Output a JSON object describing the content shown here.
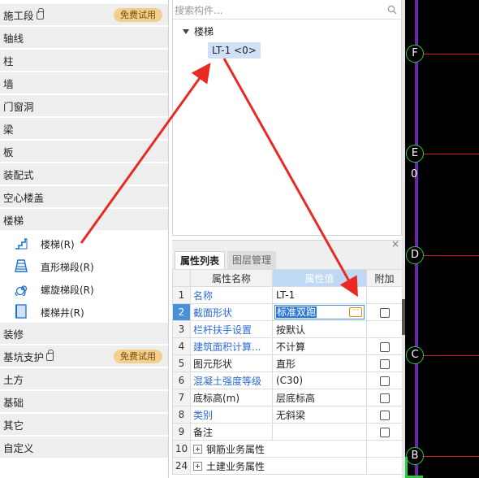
{
  "sidebar": {
    "categories": [
      {
        "label": "施工段",
        "locked": true,
        "badge": "免费试用"
      },
      {
        "label": "轴线"
      },
      {
        "label": "柱"
      },
      {
        "label": "墙"
      },
      {
        "label": "门窗洞"
      },
      {
        "label": "梁"
      },
      {
        "label": "板"
      },
      {
        "label": "装配式"
      },
      {
        "label": "空心楼盖"
      },
      {
        "label": "楼梯"
      },
      {
        "label": "装修"
      },
      {
        "label": "基坑支护",
        "locked": true,
        "badge": "免费试用"
      },
      {
        "label": "土方"
      },
      {
        "label": "基础"
      },
      {
        "label": "其它"
      },
      {
        "label": "自定义"
      }
    ],
    "stair_items": [
      {
        "label": "楼梯(R)",
        "icon": "stair-icon"
      },
      {
        "label": "直形梯段(R)",
        "icon": "straight-flight-icon"
      },
      {
        "label": "螺旋梯段(R)",
        "icon": "spiral-flight-icon"
      },
      {
        "label": "楼梯井(R)",
        "icon": "stairwell-icon"
      }
    ]
  },
  "tree": {
    "search_placeholder": "搜索构件...",
    "root_label": "楼梯",
    "selected_item": "LT-1 <0>"
  },
  "props": {
    "tabs": [
      "属性列表",
      "图层管理"
    ],
    "headers": {
      "name": "属性名称",
      "value": "属性值",
      "extra": "附加"
    },
    "rows": [
      {
        "num": "1",
        "name": "名称",
        "value": "LT-1",
        "link": true,
        "checkbox": false
      },
      {
        "num": "2",
        "name": "截面形状",
        "value": "标准双跑",
        "link": true,
        "checkbox": true,
        "editing": true
      },
      {
        "num": "3",
        "name": "栏杆扶手设置",
        "value": "按默认",
        "link": true,
        "checkbox": false
      },
      {
        "num": "4",
        "name": "建筑面积计算...",
        "value": "不计算",
        "link": true,
        "checkbox": true
      },
      {
        "num": "5",
        "name": "图元形状",
        "value": "直形",
        "link": false,
        "checkbox": true
      },
      {
        "num": "6",
        "name": "混凝土强度等级",
        "value": "(C30)",
        "link": true,
        "checkbox": true
      },
      {
        "num": "7",
        "name": "底标高(m)",
        "value": "层底标高",
        "link": false,
        "checkbox": true
      },
      {
        "num": "8",
        "name": "类别",
        "value": "无斜梁",
        "link": true,
        "checkbox": true
      },
      {
        "num": "9",
        "name": "备注",
        "value": "",
        "link": false,
        "checkbox": true
      },
      {
        "num": "10",
        "name": "钢筋业务属性",
        "value": "",
        "group": true
      },
      {
        "num": "24",
        "name": "土建业务属性",
        "value": "",
        "group": true
      }
    ]
  },
  "canvas": {
    "axis_labels": [
      "F",
      "E",
      "0",
      "D",
      "C",
      "B"
    ]
  },
  "colors": {
    "badge_bg": "#f3cf8d",
    "selected_row": "#4a90d9",
    "link_text": "#2c6bd2",
    "arrow": "#e82a22",
    "axis_bubble": "#2ec93f"
  }
}
